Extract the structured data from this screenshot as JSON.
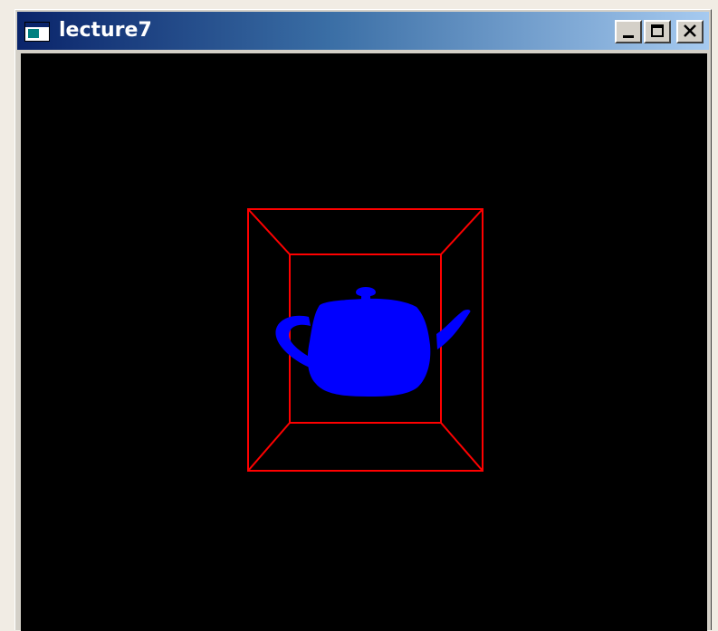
{
  "window": {
    "title": "lecture7",
    "controls": {
      "minimize": "minimize-icon",
      "maximize": "maximize-icon",
      "close": "close-icon"
    }
  },
  "colors": {
    "titlebar_start": "#0a246a",
    "titlebar_end": "#a6caf0",
    "canvas_background": "#000000",
    "wireframe_box": "#ff0000",
    "teapot": "#0000ff"
  }
}
